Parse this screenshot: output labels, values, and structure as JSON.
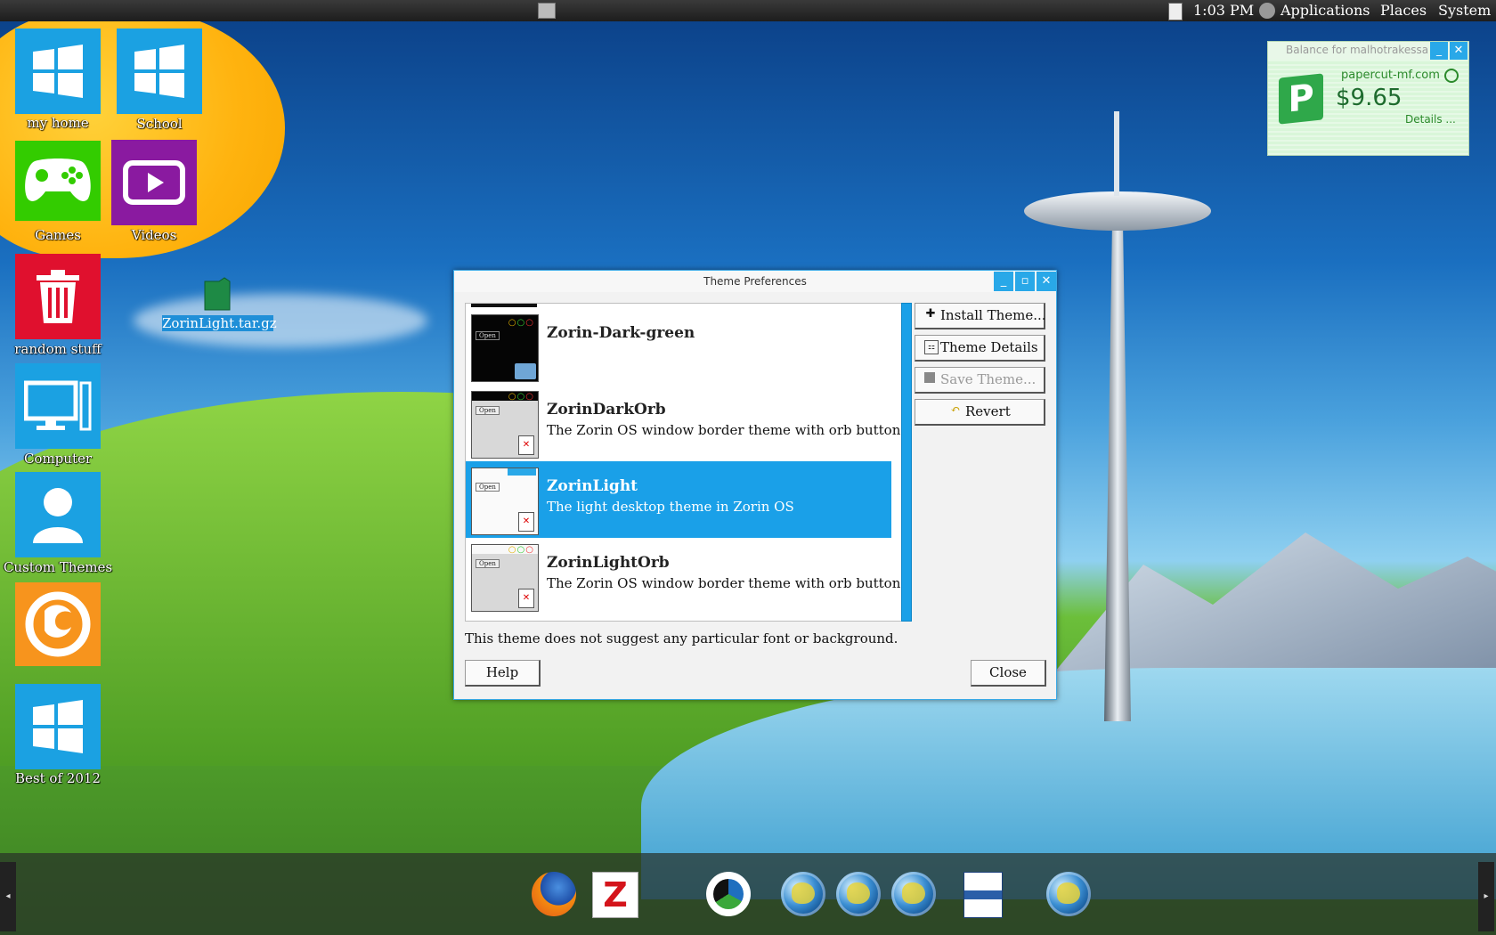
{
  "topbar": {
    "clock": "1:03 PM",
    "menus": [
      "Applications",
      "Places",
      "System"
    ]
  },
  "desktop_icons": [
    {
      "label": "my home",
      "icon": "windows-logo-icon",
      "color": "#1ba1e2"
    },
    {
      "label": "School",
      "icon": "windows-logo-icon",
      "color": "#1ba1e2"
    },
    {
      "label": "Games",
      "icon": "game-controller-icon",
      "color": "#33cc00"
    },
    {
      "label": "Videos",
      "icon": "play-icon",
      "color": "#8a1aa0"
    },
    {
      "label": "random stuff",
      "icon": "trash-icon",
      "color": "#e0102e"
    },
    {
      "label": "Computer",
      "icon": "computer-icon",
      "color": "#1ba1e2"
    },
    {
      "label": "Custom Themes",
      "icon": "user-icon",
      "color": "#1ba1e2"
    },
    {
      "label": "",
      "icon": "firefox-icon",
      "color": "#f7941d"
    },
    {
      "label": "Best of 2012",
      "icon": "windows-logo-icon",
      "color": "#1ba1e2"
    }
  ],
  "file_icon": {
    "label": "ZorinLight.tar.gz"
  },
  "widget": {
    "title": "Balance for malhotrakessa",
    "site": "papercut-mf.com",
    "balance": "$9.65",
    "details": "Details ..."
  },
  "dialog": {
    "title": "Theme Preferences",
    "themes": [
      {
        "name": "Zorin-Dark-green",
        "description": "",
        "selected": false,
        "style": "dark"
      },
      {
        "name": "ZorinDarkOrb",
        "description": "The Zorin OS window border theme with orb buttons",
        "selected": false,
        "style": "darkorb"
      },
      {
        "name": "ZorinLight",
        "description": "The light desktop theme in Zorin OS",
        "selected": true,
        "style": "light"
      },
      {
        "name": "ZorinLightOrb",
        "description": "The Zorin OS window border theme with orb buttons",
        "selected": false,
        "style": "lightorb"
      }
    ],
    "buttons": {
      "install": "Install Theme...",
      "details": "Theme Details",
      "save": "Save Theme...",
      "revert": "Revert",
      "help": "Help",
      "close": "Close"
    },
    "info": "This theme does not suggest any particular font or background.",
    "thumb_open_label": "Open"
  },
  "dock": {
    "apps": [
      "firefox-icon",
      "filezilla-icon",
      "tri-swirl-icon",
      "globe-icon",
      "globe-icon",
      "globe-icon",
      "document-icon",
      "globe-icon"
    ]
  },
  "colors": {
    "accent": "#1aa0e8",
    "topbar": "#2a2a2a"
  }
}
